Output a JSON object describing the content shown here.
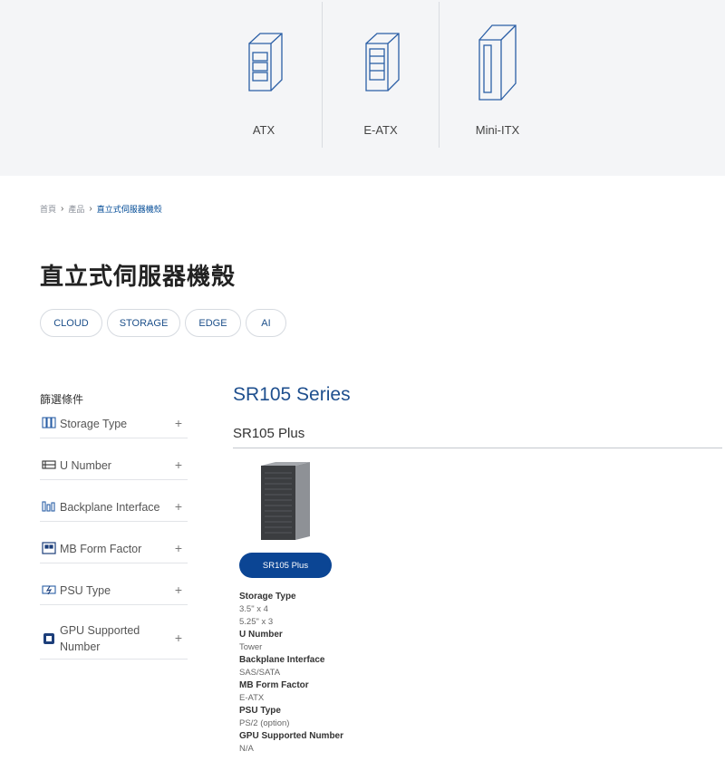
{
  "form_factors": [
    {
      "label": "ATX",
      "icon": "atx-case-icon"
    },
    {
      "label": "E-ATX",
      "icon": "eatx-case-icon"
    },
    {
      "label": "Mini-ITX",
      "icon": "mini-itx-case-icon"
    }
  ],
  "breadcrumb": {
    "items": [
      "首頁",
      "產品",
      "直立式伺服器機殼"
    ]
  },
  "page_title": "直立式伺服器機殼",
  "categories": [
    "CLOUD",
    "STORAGE",
    "EDGE",
    "AI"
  ],
  "filters": {
    "title": "篩選條件",
    "items": [
      {
        "label": "Storage Type",
        "icon": "storage-type-icon"
      },
      {
        "label": "U Number",
        "icon": "u-number-icon"
      },
      {
        "label": "Backplane Interface",
        "icon": "backplane-icon"
      },
      {
        "label": "MB Form Factor",
        "icon": "mb-form-factor-icon"
      },
      {
        "label": "PSU Type",
        "icon": "psu-icon"
      },
      {
        "label": "GPU Supported Number",
        "icon": "gpu-icon"
      }
    ],
    "expand_symbol": "+"
  },
  "series": {
    "title": "SR105 Series",
    "product": {
      "name": "SR105 Plus",
      "button_label": "SR105 Plus",
      "specs": [
        {
          "label": "Storage Type",
          "values": [
            "3.5\" x 4",
            "5.25\" x 3"
          ]
        },
        {
          "label": "U Number",
          "values": [
            "Tower"
          ]
        },
        {
          "label": "Backplane Interface",
          "values": [
            "SAS/SATA"
          ]
        },
        {
          "label": "MB Form Factor",
          "values": [
            "E-ATX"
          ]
        },
        {
          "label": "PSU Type",
          "values": [
            "PS/2 (option)"
          ]
        },
        {
          "label": "GPU Supported Number",
          "values": [
            "N/A"
          ]
        }
      ]
    }
  },
  "colors": {
    "accent": "#0b4594",
    "link": "#1e4f8e",
    "band": "#f4f5f7"
  }
}
